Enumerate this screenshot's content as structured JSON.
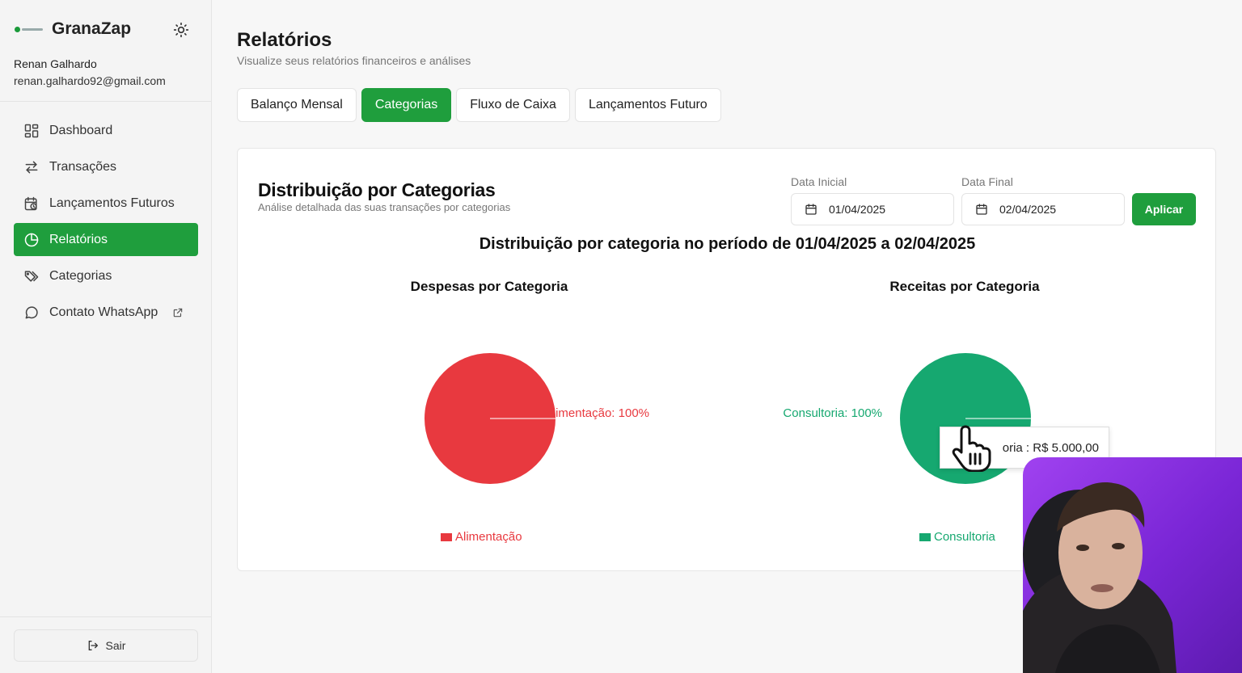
{
  "app": {
    "name": "GranaZap",
    "user_name": "Renan Galhardo",
    "user_email": "renan.galhardo92@gmail.com"
  },
  "sidebar": {
    "items": [
      {
        "label": "Dashboard",
        "icon": "dashboard-icon",
        "active": false
      },
      {
        "label": "Transações",
        "icon": "arrows-icon",
        "active": false
      },
      {
        "label": "Lançamentos Futuros",
        "icon": "calendar-clock-icon",
        "active": false
      },
      {
        "label": "Relatórios",
        "icon": "pie-chart-icon",
        "active": true
      },
      {
        "label": "Categorias",
        "icon": "tags-icon",
        "active": false
      },
      {
        "label": "Contato WhatsApp",
        "icon": "chat-icon",
        "active": false
      }
    ],
    "logout_label": "Sair"
  },
  "page": {
    "title": "Relatórios",
    "subtitle": "Visualize seus relatórios financeiros e análises"
  },
  "tabs": [
    {
      "label": "Balanço Mensal",
      "active": false
    },
    {
      "label": "Categorias",
      "active": true
    },
    {
      "label": "Fluxo de Caixa",
      "active": false
    },
    {
      "label": "Lançamentos Futuro",
      "active": false
    }
  ],
  "report": {
    "title": "Distribuição por Categorias",
    "description": "Análise detalhada das suas transações por categorias",
    "start_label": "Data Inicial",
    "start_value": "01/04/2025",
    "end_label": "Data Final",
    "end_value": "02/04/2025",
    "apply_label": "Aplicar",
    "period_title": "Distribuição por categoria no período de 01/04/2025 a 02/04/2025"
  },
  "colors": {
    "accent": "#1f9e3d",
    "expense": "#e8393f",
    "income": "#16a870"
  },
  "chart_data": [
    {
      "type": "pie",
      "title": "Despesas por Categoria",
      "categories": [
        "Alimentação"
      ],
      "values": [
        100
      ],
      "slice_labels": [
        "Alimentação: 100%"
      ],
      "legend": [
        "Alimentação"
      ],
      "colors": [
        "#e8393f"
      ]
    },
    {
      "type": "pie",
      "title": "Receitas por Categoria",
      "categories": [
        "Consultoria"
      ],
      "values": [
        100
      ],
      "slice_labels": [
        "Consultoria: 100%"
      ],
      "legend": [
        "Consultoria"
      ],
      "colors": [
        "#16a870"
      ],
      "tooltip": "oria : R$ 5.000,00"
    }
  ]
}
